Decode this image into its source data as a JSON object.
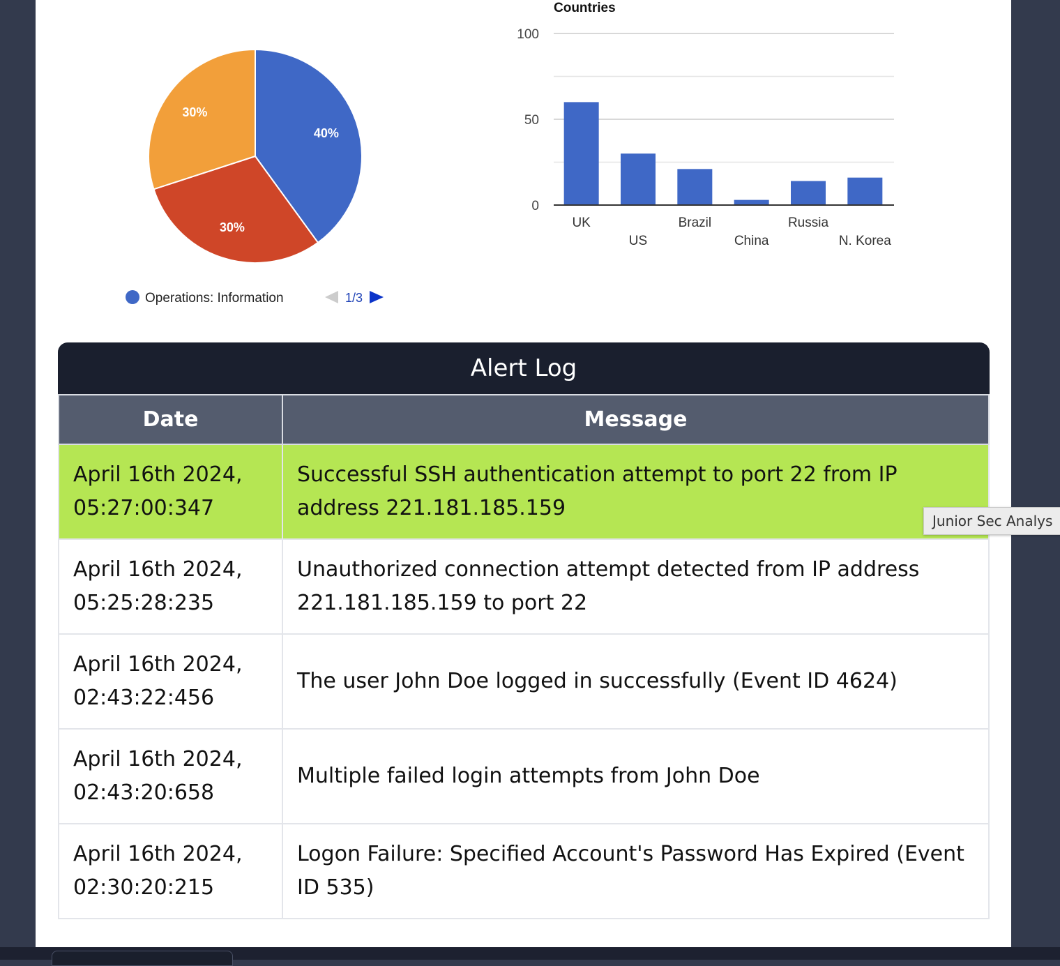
{
  "pie_chart": {
    "type": "pie",
    "slices": [
      {
        "label": "Operations: Information",
        "value": 40,
        "text": "40%",
        "color": "#3f68c6"
      },
      {
        "value": 30,
        "text": "30%",
        "color": "#cf4628"
      },
      {
        "value": 30,
        "text": "30%",
        "color": "#f29f3a"
      }
    ],
    "legend": {
      "entry": "Operations: Information",
      "color": "#3f68c6",
      "pager": "1/3"
    }
  },
  "chart_data": {
    "type": "bar",
    "title": "Countries",
    "categories": [
      "UK",
      "US",
      "Brazil",
      "China",
      "Russia",
      "N. Korea"
    ],
    "values": [
      60,
      30,
      21,
      3,
      14,
      16
    ],
    "ylim": [
      0,
      100
    ],
    "yticks": [
      "0",
      "50",
      "100"
    ],
    "bar_color": "#3f68c6",
    "grid": true
  },
  "alert_log": {
    "title": "Alert Log",
    "columns": [
      "Date",
      "Message"
    ],
    "rows": [
      {
        "date": "April 16th 2024, 05:27:00:347",
        "message": "Successful SSH authentication attempt to port 22 from IP address 221.181.185.159",
        "highlight": true
      },
      {
        "date": "April 16th 2024, 05:25:28:235",
        "message": "Unauthorized connection attempt detected from IP address 221.181.185.159 to port 22",
        "highlight": false
      },
      {
        "date": "April 16th 2024, 02:43:22:456",
        "message": "The user John Doe logged in successfully (Event ID 4624)",
        "highlight": false
      },
      {
        "date": "April 16th 2024, 02:43:20:658",
        "message": "Multiple failed login attempts from John Doe",
        "highlight": false
      },
      {
        "date": "April 16th 2024, 02:30:20:215",
        "message": "Logon Failure: Specified Account's Password Has Expired (Event ID 535)",
        "highlight": false
      }
    ],
    "highlight_color": "#b5e653"
  },
  "tooltip": {
    "text": "Junior Sec Analys"
  }
}
